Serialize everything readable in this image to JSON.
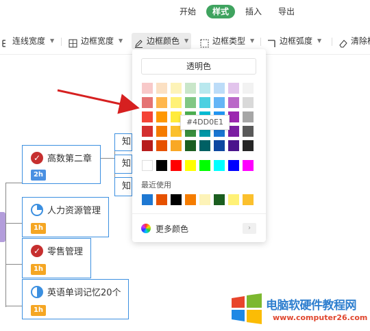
{
  "top_menu": {
    "items": [
      {
        "label": "开始"
      },
      {
        "label": "样式"
      },
      {
        "label": "插入"
      },
      {
        "label": "导出"
      }
    ]
  },
  "toolbar": {
    "line_width": "连线宽度",
    "border_width": "边框宽度",
    "border_color": "边框颜色",
    "border_type": "边框类型",
    "border_radius": "边框弧度",
    "clear": "清除样"
  },
  "popup": {
    "transparent_label": "透明色",
    "recent_label": "最近使用",
    "more_colors_label": "更多颜色",
    "tooltip": "#4DD0E1",
    "palette": [
      [
        "#f8c9c9",
        "#fbe0c3",
        "#fdf3b8",
        "#c9e6c9",
        "#b9e8ee",
        "#bcdcf8",
        "#e2c4ec",
        "#f2f2f2"
      ],
      [
        "#e57373",
        "#ffb74d",
        "#fff176",
        "#81c784",
        "#4dd0e1",
        "#64b5f6",
        "#ba68c8",
        "#d9d9d9"
      ],
      [
        "#f44336",
        "#ff9800",
        "#ffeb3b",
        "#4caf50",
        "#00bcd4",
        "#2196f3",
        "#9c27b0",
        "#a6a6a6"
      ],
      [
        "#d32f2f",
        "#f57c00",
        "#fbc02d",
        "#388e3c",
        "#0097a7",
        "#1976d2",
        "#7b1fa2",
        "#595959"
      ],
      [
        "#b71c1c",
        "#e65100",
        "#f9a825",
        "#1b5e20",
        "#006064",
        "#0d47a1",
        "#4a148c",
        "#262626"
      ]
    ],
    "basic_colors": [
      "#ffffff",
      "#000000",
      "#ff0000",
      "#ffff00",
      "#00ff00",
      "#00ffff",
      "#0000ff",
      "#ff00ff"
    ],
    "recent_colors": [
      "#1e78d2",
      "#e65100",
      "#000000",
      "#f57c00",
      "#fdf3b8",
      "#1b5e20",
      "#fff176",
      "#fbc02d"
    ]
  },
  "mindmap": {
    "nodes": [
      {
        "title": "高数第二章",
        "badge": "2h",
        "icon": "check-icon",
        "badge_color": "#4a90e2"
      },
      {
        "title": "人力资源管理",
        "badge": "1h",
        "icon": "pie-quarter-icon",
        "badge_color": "#f5a623"
      },
      {
        "title": "零售管理",
        "badge": "1h",
        "icon": "check-icon",
        "badge_color": "#f5a623"
      },
      {
        "title": "英语单词记忆20个",
        "badge": "1h",
        "icon": "pie-half-icon",
        "badge_color": "#f5a623"
      }
    ],
    "sub_nodes": [
      "知",
      "知",
      "知"
    ]
  },
  "watermark": {
    "line1": "电脑软硬件教程网",
    "line2": "www.computer26.com"
  }
}
